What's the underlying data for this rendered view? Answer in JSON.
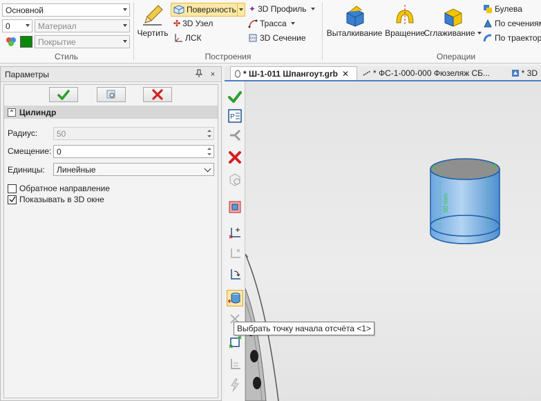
{
  "ribbon": {
    "style_group": {
      "style_combo": "Основной",
      "layer_value": "0",
      "material_placeholder": "Материал",
      "coating_placeholder": "Покрытие",
      "label": "Стиль"
    },
    "build_group": {
      "draw_label": "Чертить",
      "surface_label": "Поверхность",
      "profile3d_label": "3D Профиль",
      "node3d_label": "3D Узел",
      "path_label": "Трасса",
      "lcs_label": "ЛСК",
      "section3d_label": "3D Сечение",
      "label": "Построения"
    },
    "ops_group": {
      "extrude_label": "Выталкивание",
      "rotate_label": "Вращение",
      "smooth_label": "Сглаживание",
      "boolean_label": "Булева",
      "by_sections_label": "По сечениям",
      "by_path_label": "По траектор",
      "label": "Операции"
    }
  },
  "panel": {
    "title": "Параметры",
    "pin_glyph": "📌",
    "close_glyph": "×",
    "section_title": "Цилиндр",
    "radius_label": "Радиус:",
    "radius_value": "50",
    "offset_label": "Смещение:",
    "offset_value": "0",
    "units_label": "Единицы:",
    "units_value": "Линейные",
    "reverse_label": "Обратное направление",
    "show3d_label": "Показывать в 3D окне"
  },
  "tabs": [
    {
      "label": "* Ш-1-011 Шпангоут.grb",
      "close": "✕"
    },
    {
      "label": "* ФС-1-000-000 Фюзеляж СБ...",
      "close": ""
    },
    {
      "label": "* 3D",
      "close": ""
    }
  ],
  "viewport": {
    "dimension_label": "50 mm",
    "tooltip": "Выбрать точку начала отсчёта <1>"
  },
  "colors": {
    "accent_yellow": "#fde9a6",
    "check_green": "#2e9e2e",
    "cancel_red": "#d42020",
    "cylinder_blue": "#5b9bd5",
    "arrow_red": "#e02020"
  }
}
